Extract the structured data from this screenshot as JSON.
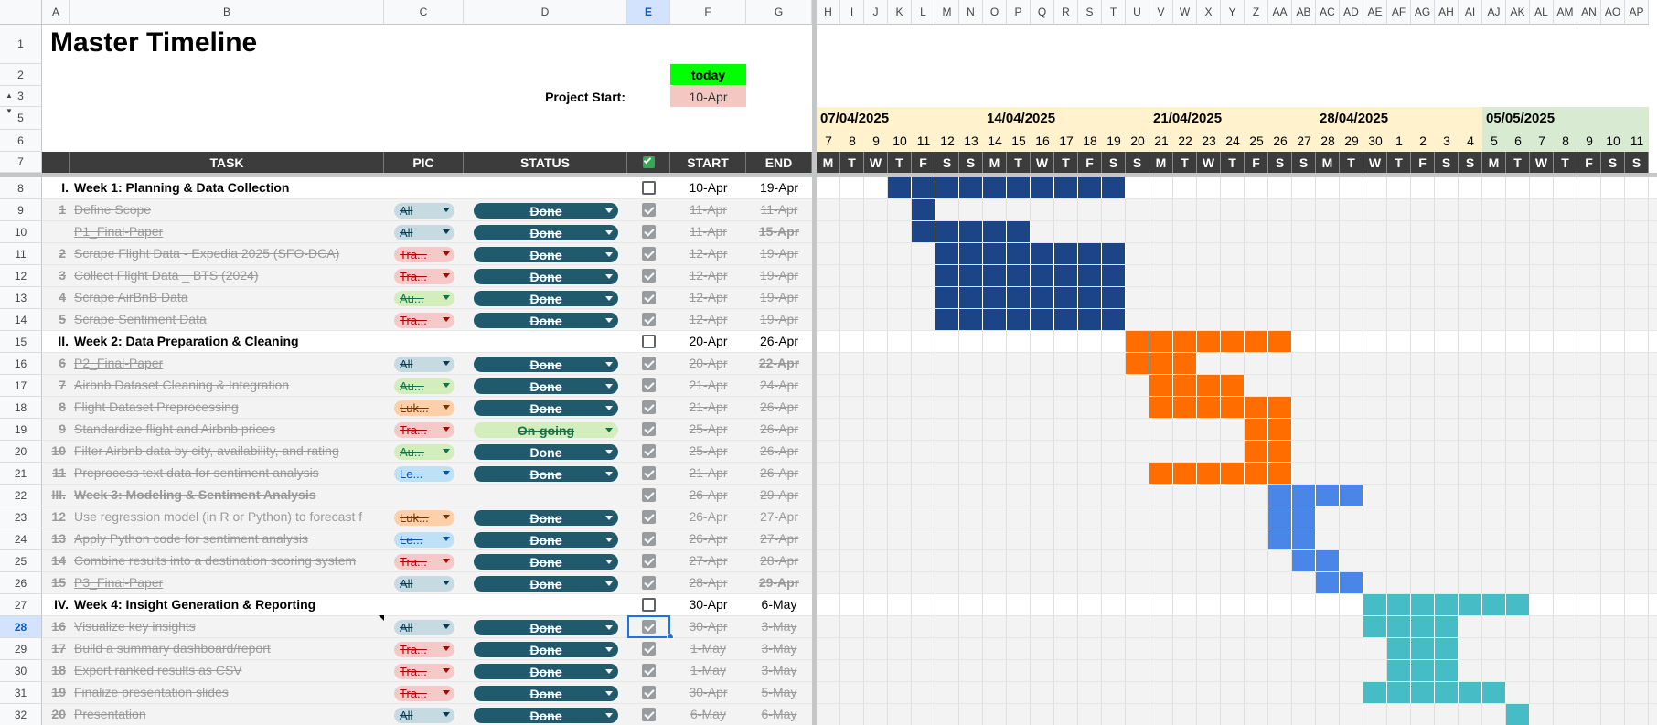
{
  "sheet": {
    "title": "Master Timeline",
    "today_label": "today",
    "project_start_label": "Project Start:",
    "project_start_value": "10-Apr"
  },
  "columns": [
    "A",
    "B",
    "C",
    "D",
    "E",
    "F",
    "G",
    "H",
    "I",
    "J",
    "K",
    "L",
    "M",
    "N",
    "O",
    "P",
    "Q",
    "R",
    "S",
    "T",
    "U",
    "V",
    "W",
    "X",
    "Y",
    "Z",
    "AA",
    "AB",
    "AC",
    "AD",
    "AE",
    "AF",
    "AG",
    "AH",
    "AI",
    "AJ",
    "AK",
    "AL",
    "AM",
    "AN",
    "AO",
    "AP"
  ],
  "row_numbers": [
    "1",
    "2",
    "3",
    "5",
    "6",
    "7",
    "8",
    "9",
    "10",
    "11",
    "12",
    "13",
    "14",
    "15",
    "16",
    "17",
    "18",
    "19",
    "20",
    "21",
    "22",
    "23",
    "24",
    "25",
    "26",
    "27",
    "28",
    "29",
    "30",
    "31",
    "32"
  ],
  "headers": {
    "task": "TASK",
    "pic": "PIC",
    "status": "STATUS",
    "start": "START",
    "end": "END"
  },
  "timeline": {
    "weeks": [
      "07/04/2025",
      "14/04/2025",
      "21/04/2025",
      "28/04/2025",
      "05/05/2025"
    ],
    "days": [
      "7",
      "8",
      "9",
      "10",
      "11",
      "12",
      "13",
      "14",
      "15",
      "16",
      "17",
      "18",
      "19",
      "20",
      "21",
      "22",
      "23",
      "24",
      "25",
      "26",
      "27",
      "28",
      "29",
      "30",
      "1",
      "2",
      "3",
      "4",
      "5",
      "6",
      "7",
      "8",
      "9",
      "10",
      "11"
    ],
    "dow": [
      "M",
      "T",
      "W",
      "T",
      "F",
      "S",
      "S",
      "M",
      "T",
      "W",
      "T",
      "F",
      "S",
      "S",
      "M",
      "T",
      "W",
      "T",
      "F",
      "S",
      "S",
      "M",
      "T",
      "W",
      "T",
      "F",
      "S",
      "S",
      "M",
      "T",
      "W",
      "T",
      "F",
      "S",
      "S"
    ]
  },
  "colors": {
    "week1": "#1c4587",
    "week2": "#ff6d01",
    "week3": "#4a86e8",
    "week4": "#46bdc6",
    "status_done": "#215a6c",
    "status_ongoing": "#d4edbc"
  },
  "rows": [
    {
      "num": "I.",
      "task": "Week 1: Planning & Data Collection",
      "type": "sec",
      "checked": false,
      "start": "10-Apr",
      "end": "19-Apr",
      "bar": [
        3,
        12
      ],
      "color": "#1c4587"
    },
    {
      "num": "1",
      "task": "Define Scope",
      "type": "sub",
      "pic": "All",
      "pic_style": "all",
      "status": "Done",
      "checked": true,
      "start": "11-Apr",
      "end": "11-Apr",
      "bar": [
        4,
        4
      ],
      "color": "#1c4587"
    },
    {
      "num": "",
      "task": "P1_Final-Paper",
      "type": "sub",
      "underline": true,
      "pic": "All",
      "pic_style": "all",
      "status": "Done",
      "checked": true,
      "start": "11-Apr",
      "end": "15-Apr",
      "end_bold": true,
      "bar": [
        4,
        8
      ],
      "color": "#1c4587"
    },
    {
      "num": "2",
      "task": "Scrape Flight Data - Expedia 2025 (SFO-DCA)",
      "type": "sub",
      "pic": "Tra...",
      "pic_style": "tra",
      "status": "Done",
      "checked": true,
      "start": "12-Apr",
      "end": "19-Apr",
      "bar": [
        5,
        12
      ],
      "color": "#1c4587"
    },
    {
      "num": "3",
      "task": "Collect Flight Data _ BTS (2024)",
      "type": "sub",
      "pic": "Tra...",
      "pic_style": "tra",
      "status": "Done",
      "checked": true,
      "start": "12-Apr",
      "end": "19-Apr",
      "bar": [
        5,
        12
      ],
      "color": "#1c4587"
    },
    {
      "num": "4",
      "task": "Scrape AirBnB Data",
      "type": "sub",
      "pic": "Au...",
      "pic_style": "au",
      "status": "Done",
      "checked": true,
      "start": "12-Apr",
      "end": "19-Apr",
      "bar": [
        5,
        12
      ],
      "color": "#1c4587"
    },
    {
      "num": "5",
      "task": "Scrape Sentiment Data",
      "type": "sub",
      "pic": "Tra...",
      "pic_style": "tra",
      "status": "Done",
      "checked": true,
      "start": "12-Apr",
      "end": "19-Apr",
      "bar": [
        5,
        12
      ],
      "color": "#1c4587"
    },
    {
      "num": "II.",
      "task": "Week 2: Data Preparation & Cleaning",
      "type": "sec",
      "checked": false,
      "start": "20-Apr",
      "end": "26-Apr",
      "bar": [
        13,
        19
      ],
      "color": "#ff6d01"
    },
    {
      "num": "6",
      "task": "P2_Final-Paper",
      "type": "sub",
      "underline": true,
      "pic": "All",
      "pic_style": "all",
      "status": "Done",
      "checked": true,
      "start": "20-Apr",
      "end": "22-Apr",
      "end_bold": true,
      "bar": [
        13,
        15
      ],
      "color": "#ff6d01"
    },
    {
      "num": "7",
      "task": "Airbnb Dataset Cleaning & Integration",
      "type": "sub",
      "pic": "Au...",
      "pic_style": "au",
      "status": "Done",
      "checked": true,
      "start": "21-Apr",
      "end": "24-Apr",
      "bar": [
        14,
        17
      ],
      "color": "#ff6d01"
    },
    {
      "num": "8",
      "task": "Flight Dataset Preprocessing",
      "type": "sub",
      "pic": "Luk...",
      "pic_style": "luk",
      "status": "Done",
      "checked": true,
      "start": "21-Apr",
      "end": "26-Apr",
      "bar": [
        14,
        19
      ],
      "color": "#ff6d01"
    },
    {
      "num": "9",
      "task": "Standardize flight and Airbnb prices",
      "type": "sub",
      "pic": "Tra...",
      "pic_style": "tra",
      "status": "On-going",
      "status_style": "ongoing",
      "checked": true,
      "start": "25-Apr",
      "end": "26-Apr",
      "bar": [
        18,
        19
      ],
      "color": "#ff6d01"
    },
    {
      "num": "10",
      "task": "Filter Airbnb data by city, availability, and rating",
      "type": "sub",
      "pic": "Au...",
      "pic_style": "au",
      "status": "Done",
      "checked": true,
      "start": "25-Apr",
      "end": "26-Apr",
      "bar": [
        18,
        19
      ],
      "color": "#ff6d01"
    },
    {
      "num": "11",
      "task": "Preprocess text data for sentiment analysis",
      "type": "sub",
      "pic": "Le...",
      "pic_style": "le",
      "status": "Done",
      "checked": true,
      "start": "21-Apr",
      "end": "26-Apr",
      "bar": [
        14,
        19
      ],
      "color": "#ff6d01"
    },
    {
      "num": "III.",
      "task": "Week 3: Modeling & Sentiment Analysis",
      "type": "sub",
      "muted_sec": true,
      "checked": true,
      "start": "26-Apr",
      "end": "29-Apr",
      "bar": [
        19,
        22
      ],
      "color": "#4a86e8"
    },
    {
      "num": "12",
      "task": "Use regression model (in R or Python) to forecast f",
      "type": "sub",
      "pic": "Luk...",
      "pic_style": "luk",
      "status": "Done",
      "checked": true,
      "start": "26-Apr",
      "end": "27-Apr",
      "bar": [
        19,
        20
      ],
      "color": "#4a86e8"
    },
    {
      "num": "13",
      "task": "Apply Python code for sentiment analysis",
      "type": "sub",
      "pic": "Le...",
      "pic_style": "le",
      "status": "Done",
      "checked": true,
      "start": "26-Apr",
      "end": "27-Apr",
      "bar": [
        19,
        20
      ],
      "color": "#4a86e8"
    },
    {
      "num": "14",
      "task": "Combine results into a destination scoring system",
      "type": "sub",
      "pic": "Tra...",
      "pic_style": "tra",
      "status": "Done",
      "checked": true,
      "start": "27-Apr",
      "end": "28-Apr",
      "bar": [
        20,
        21
      ],
      "color": "#4a86e8"
    },
    {
      "num": "15",
      "task": "P3_Final-Paper",
      "type": "sub",
      "underline": true,
      "pic": "All",
      "pic_style": "all",
      "status": "Done",
      "checked": true,
      "start": "28-Apr",
      "end": "29-Apr",
      "end_bold": true,
      "bar": [
        21,
        22
      ],
      "color": "#4a86e8"
    },
    {
      "num": "IV.",
      "task": "Week 4: Insight Generation & Reporting",
      "type": "sec",
      "checked": false,
      "start": "30-Apr",
      "end": "6-May",
      "bar": [
        23,
        29
      ],
      "color": "#46bdc6"
    },
    {
      "num": "16",
      "task": "Visualize key insights",
      "type": "sub",
      "pic": "All",
      "pic_style": "all",
      "status": "Done",
      "checked": true,
      "start": "30-Apr",
      "end": "3-May",
      "bar": [
        23,
        26
      ],
      "color": "#46bdc6",
      "selected": true
    },
    {
      "num": "17",
      "task": "Build a summary dashboard/report",
      "type": "sub",
      "pic": "Tra...",
      "pic_style": "tra",
      "status": "Done",
      "checked": true,
      "start": "1-May",
      "end": "3-May",
      "bar": [
        24,
        26
      ],
      "color": "#46bdc6"
    },
    {
      "num": "18",
      "task": "Export ranked results as CSV",
      "type": "sub",
      "pic": "Tra...",
      "pic_style": "tra",
      "status": "Done",
      "checked": true,
      "start": "1-May",
      "end": "3-May",
      "bar": [
        24,
        26
      ],
      "color": "#46bdc6"
    },
    {
      "num": "19",
      "task": "Finalize presentation slides",
      "type": "sub",
      "pic": "Tra...",
      "pic_style": "tra",
      "status": "Done",
      "checked": true,
      "start": "30-Apr",
      "end": "5-May",
      "bar": [
        23,
        28
      ],
      "color": "#46bdc6"
    },
    {
      "num": "20",
      "task": "Presentation",
      "type": "sub",
      "pic": "All",
      "pic_style": "all",
      "status": "Done",
      "checked": true,
      "start": "6-May",
      "end": "6-May",
      "bar": [
        29,
        29
      ],
      "color": "#46bdc6"
    }
  ]
}
